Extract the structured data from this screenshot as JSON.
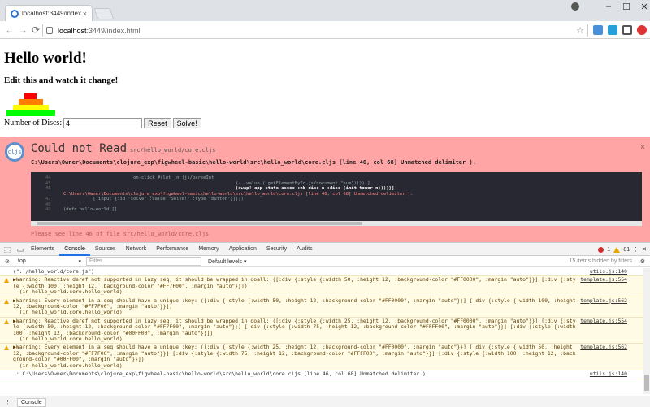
{
  "browser": {
    "tab_title": "localhost:3449/index.ht",
    "tab_close": "×",
    "url_host": "localhost",
    "url_rest": ":3449/index.html",
    "window_controls": [
      "–",
      "☐",
      "✕"
    ]
  },
  "page": {
    "heading": "Hello world!",
    "subheading": "Edit this and watch it change!",
    "discs_label": "Number of Discs:",
    "discs_value": "4",
    "reset_label": "Reset",
    "solve_label": "Solve!",
    "tower_colors": [
      "#FF0000",
      "#FF7F00",
      "#FFFF00",
      "#00FF00"
    ]
  },
  "overlay": {
    "logo_text": "cljs",
    "title": "Could not Read",
    "file": "src/hello_world/core.cljs",
    "close": "×",
    "message": "C:\\Users\\Owner\\Documents\\clojure_exp\\figwheel-basic\\hello-world\\src\\hello_world\\core.cljs [line 46, col 68] Unmatched delimiter ).",
    "code_lines": [
      {
        "n": "44",
        "text": "                         :on-click #(let [n (js/parseInt",
        "kind": ""
      },
      {
        "n": "45",
        "text": "                                                                (-.-value (.getElementById js/document \"num\")))) ]",
        "kind": ""
      },
      {
        "n": "46",
        "text": "                                                                (swap! app-state assoc :nb-disc n :disc (init-tower n))))}]",
        "kind": "hl"
      },
      {
        "n": "",
        "text": "C:\\Users\\Owner\\Documents\\clojure_exp\\figwheel-basic\\hello-world\\src\\hello_world\\core.cljs [line 46, col 68] Unmatched delimiter ).",
        "kind": "er"
      },
      {
        "n": "47",
        "text": "           [:input {:id \"solve\" :value \"Solve!\" :type \"button\"}]]))",
        "kind": ""
      },
      {
        "n": "48",
        "text": "",
        "kind": ""
      },
      {
        "n": "49",
        "text": "(defn hello-world []",
        "kind": ""
      }
    ],
    "see_line": "Please see line 46 of file src/hello_world/core.cljs"
  },
  "devtools": {
    "tabs": [
      "Elements",
      "Console",
      "Sources",
      "Network",
      "Performance",
      "Memory",
      "Application",
      "Security",
      "Audits"
    ],
    "active_tab": "Console",
    "error_count": "1",
    "warning_count": "81",
    "more": "⋮",
    "close": "✕",
    "context": "top",
    "filter_placeholder": "Filter",
    "levels": "Default levels ▾",
    "hidden": "15 items hidden by filters",
    "drawer_tab": "Console",
    "rows": [
      {
        "warn": false,
        "text": "(\"../hello_world/core.js\")",
        "src": "utils.js:140"
      },
      {
        "warn": true,
        "text": "▶Warning: Reactive deref not supported in lazy seq, it should be wrapped in doall: ([:div {:style {:width 50, :height 12, :background-color \"#FF0000\", :margin \"auto\"}}] [:div {:style {:width 100, :height 12, :background-color \"#FF7F00\", :margin \"auto\"}}])\n  (in hello_world.core.hello_world)",
        "src": "template.js:554"
      },
      {
        "warn": true,
        "text": "▶Warning: Every element in a seq should have a unique :key: ([:div {:style {:width 50, :height 12, :background-color \"#FF0000\", :margin \"auto\"}}] [:div {:style {:width 100, :height 12, :background-color \"#FF7F00\", :margin \"auto\"}}])\n  (in hello_world.core.hello_world)",
        "src": "template.js:562"
      },
      {
        "warn": true,
        "text": "▶Warning: Reactive deref not supported in lazy seq, it should be wrapped in doall: ([:div {:style {:width 25, :height 12, :background-color \"#FF0000\", :margin \"auto\"}}] [:div {:style {:width 50, :height 12, :background-color \"#FF7F00\", :margin \"auto\"}}] [:div {:style {:width 75, :height 12, :background-color \"#FFFF00\", :margin \"auto\"}}] [:div {:style {:width 100, :height 12, :background-color \"#00FF00\", :margin \"auto\"}}])\n  (in hello_world.core.hello_world)",
        "src": "template.js:554"
      },
      {
        "warn": true,
        "text": "▶Warning: Every element in a seq should have a unique :key: ([:div {:style {:width 25, :height 12, :background-color \"#FF0000\", :margin \"auto\"}}] [:div {:style {:width 50, :height 12, :background-color \"#FF7F00\", :margin \"auto\"}}] [:div {:style {:width 75, :height 12, :background-color \"#FFFF00\", :margin \"auto\"}}] [:div {:style {:width 100, :height 12, :background-color \"#00FF00\", :margin \"auto\"}}])\n  (in hello_world.core.hello_world)",
        "src": "template.js:562"
      },
      {
        "warn": false,
        "text": " : C:\\Users\\Owner\\Documents\\clojure_exp\\figwheel-basic\\hello-world\\src\\hello_world\\core.cljs [line 46, col 68] Unmatched delimiter ).",
        "src": "utils.js:140"
      }
    ]
  }
}
